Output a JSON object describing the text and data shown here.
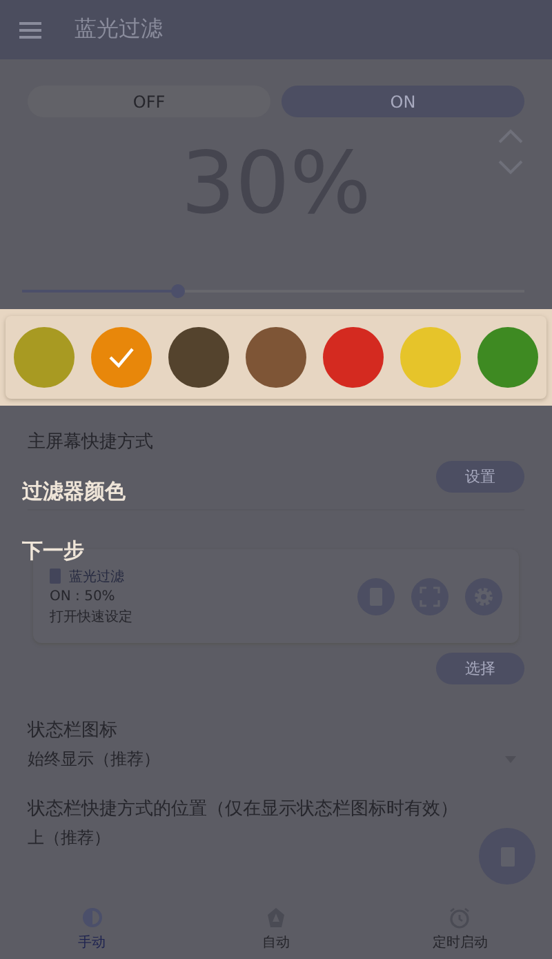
{
  "app_bar": {
    "title": "蓝光过滤"
  },
  "power": [
    {
      "label": "OFF",
      "selected": false
    },
    {
      "label": "ON",
      "selected": true
    }
  ],
  "intensity": {
    "reading": "30%",
    "level": 0.31
  },
  "filter_colors": [
    {
      "color": "#a89a22",
      "selected": false
    },
    {
      "color": "#e8870a",
      "selected": true
    },
    {
      "color": "#54432d",
      "selected": false
    },
    {
      "color": "#7e5536",
      "selected": false
    },
    {
      "color": "#d42a20",
      "selected": false
    },
    {
      "color": "#e6c42a",
      "selected": false
    },
    {
      "color": "#3e8a22",
      "selected": false
    }
  ],
  "home_shortcut": {
    "label": "主屏幕快捷方式",
    "button": "设置"
  },
  "notification": {
    "app": "蓝光过滤",
    "status": "ON : 50%",
    "hint": "打开快速设定",
    "button": "选择"
  },
  "status_icon": {
    "label": "状态栏图标",
    "value": "始终显示（推荐）"
  },
  "shortcut_position": {
    "label": "状态栏快捷方式的位置（仅在显示状态栏图标时有效）",
    "value": "上（推荐）"
  },
  "nav": [
    {
      "label": "手动",
      "selected": true
    },
    {
      "label": "自动",
      "selected": false
    },
    {
      "label": "定时启动",
      "selected": false
    }
  ],
  "tutorial": {
    "title": "过滤器颜色",
    "next": "下一步"
  }
}
